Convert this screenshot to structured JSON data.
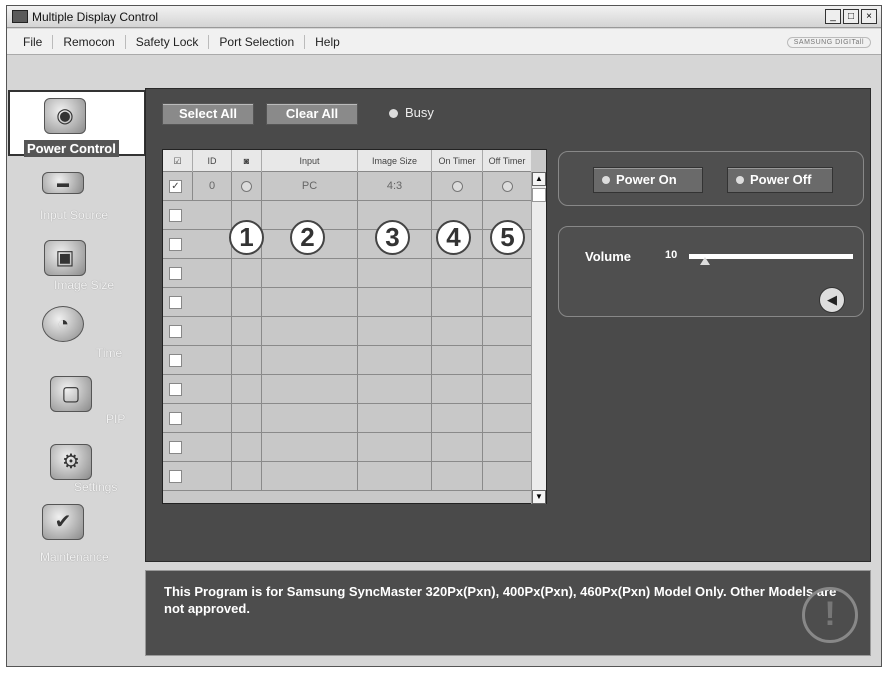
{
  "window": {
    "title": "Multiple Display Control",
    "controls": [
      "_",
      "□",
      "×"
    ]
  },
  "menu": {
    "items": [
      "File",
      "Remocon",
      "Safety Lock",
      "Port Selection",
      "Help"
    ],
    "brand": "SAMSUNG DIGITall"
  },
  "nav": {
    "items": [
      {
        "label": "Power Control",
        "icon": "power-control-icon"
      },
      {
        "label": "Input Source",
        "icon": "input-source-icon"
      },
      {
        "label": "Image Size",
        "icon": "image-size-icon"
      },
      {
        "label": "Time",
        "icon": "time-icon"
      },
      {
        "label": "PIP",
        "icon": "pip-icon"
      },
      {
        "label": "Settings",
        "icon": "settings-icon"
      },
      {
        "label": "Maintenance",
        "icon": "maintenance-icon"
      }
    ]
  },
  "toolbar": {
    "select_all": "Select All",
    "clear_all": "Clear All",
    "busy": "Busy"
  },
  "grid": {
    "headers": [
      "☑",
      "ID",
      "◙",
      "Input",
      "Image Size",
      "On Timer",
      "Off Timer"
    ],
    "row0": {
      "checkbox": "✓",
      "id": "0",
      "input": "PC",
      "image_size": "4:3"
    },
    "callouts": [
      "1",
      "2",
      "3",
      "4",
      "5"
    ]
  },
  "power": {
    "on": "Power On",
    "off": "Power Off"
  },
  "volume": {
    "label": "Volume",
    "value": "10",
    "level_percent": 10
  },
  "footer": {
    "message": "This Program is for Samsung SyncMaster 320Px(Pxn), 400Px(Pxn), 460Px(Pxn)  Model Only. Other Models are not approved.",
    "icon": "!"
  },
  "colors": {
    "panel": "#4a4a4a",
    "chrome": "#d6d6d6"
  }
}
